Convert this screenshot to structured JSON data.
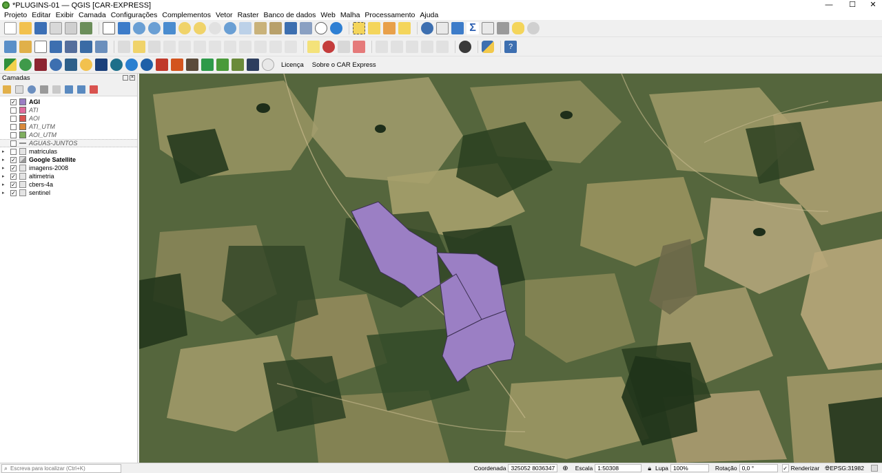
{
  "window": {
    "title": "*PLUGINS-01 — QGIS [CAR-EXPRESS]",
    "minimize": "—",
    "maximize": "☐",
    "close": "✕"
  },
  "menu": [
    "Projeto",
    "Editar",
    "Exibir",
    "Camada",
    "Configurações",
    "Complementos",
    "Vetor",
    "Raster",
    "Banco de dados",
    "Web",
    "Malha",
    "Processamento",
    "Ajuda"
  ],
  "plugin_toolbar": {
    "license": "Licença",
    "about": "Sobre o CAR Express"
  },
  "layers_panel": {
    "title": "Camadas",
    "layers": [
      {
        "name": "AGI",
        "checked": true,
        "style": "bold",
        "swatch": "#9b7fc4",
        "kind": "polygon"
      },
      {
        "name": "ATI",
        "checked": false,
        "style": "italic",
        "swatch": "#e06a9c",
        "kind": "polygon"
      },
      {
        "name": "AOI",
        "checked": false,
        "style": "italic",
        "swatch": "#d9534f",
        "kind": "polygon"
      },
      {
        "name": "ATI_UTM",
        "checked": false,
        "style": "italic",
        "swatch": "#d98a3c",
        "kind": "polygon"
      },
      {
        "name": "AOI_UTM",
        "checked": false,
        "style": "italic",
        "swatch": "#7fae5e",
        "kind": "polygon"
      },
      {
        "name": "AGUAS-JUNTOS",
        "checked": false,
        "style": "italic",
        "swatch": "#8a8a8a",
        "kind": "line"
      },
      {
        "name": "matriculas",
        "checked": false,
        "style": "normal",
        "kind": "group"
      },
      {
        "name": "Google Satellite",
        "checked": true,
        "style": "bold",
        "kind": "raster"
      },
      {
        "name": "imagens-2008",
        "checked": true,
        "style": "normal",
        "kind": "group"
      },
      {
        "name": "altimetria",
        "checked": true,
        "style": "normal",
        "kind": "group"
      },
      {
        "name": "cbers-4a",
        "checked": true,
        "style": "normal",
        "kind": "group"
      },
      {
        "name": "sentinel",
        "checked": true,
        "style": "normal",
        "kind": "group"
      }
    ]
  },
  "status": {
    "locator_placeholder": "Escreva para localizar (Ctrl+K)",
    "coordinate_label": "Coordenada",
    "coordinate": "325052  8036347",
    "scale_label": "Escala",
    "scale": "1:50308",
    "magnifier_label": "Lupa",
    "magnifier": "100%",
    "rotation_label": "Rotação",
    "rotation": "0,0 °",
    "render_label": "Renderizar",
    "crs": "EPSG:31982"
  },
  "colors": {
    "polygon_fill": "#9b7fc4",
    "polygon_stroke": "#3d3154"
  }
}
